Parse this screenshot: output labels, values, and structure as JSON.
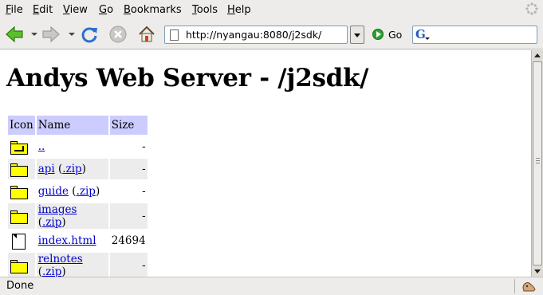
{
  "menu": {
    "items": [
      {
        "label": "File",
        "key": "F",
        "rest": "ile"
      },
      {
        "label": "Edit",
        "key": "E",
        "rest": "dit"
      },
      {
        "label": "View",
        "key": "V",
        "rest": "iew"
      },
      {
        "label": "Go",
        "key": "G",
        "rest": "o"
      },
      {
        "label": "Bookmarks",
        "key": "B",
        "rest": "ookmarks"
      },
      {
        "label": "Tools",
        "key": "T",
        "rest": "ools"
      },
      {
        "label": "Help",
        "key": "H",
        "rest": "elp"
      }
    ]
  },
  "toolbar": {
    "url": "http://nyangau:8080/j2sdk/",
    "go_label": "Go",
    "search_engine_letter": "G",
    "search_value": ""
  },
  "page": {
    "title": "Andys Web Server - /j2sdk/",
    "headers": {
      "icon": "Icon",
      "name": "Name",
      "size": "Size"
    },
    "rows": [
      {
        "icon": "parent-folder-icon",
        "name": "..",
        "zip": "",
        "size": "-"
      },
      {
        "icon": "folder-icon",
        "name": "api",
        "zip": ".zip",
        "size": "-"
      },
      {
        "icon": "folder-icon",
        "name": "guide",
        "zip": ".zip",
        "size": "-"
      },
      {
        "icon": "folder-icon",
        "name": "images",
        "zip": ".zip",
        "size": "-"
      },
      {
        "icon": "document-icon",
        "name": "index.html",
        "zip": "",
        "size": "24694"
      },
      {
        "icon": "folder-icon",
        "name": "relnotes",
        "zip": ".zip",
        "size": "-"
      }
    ]
  },
  "status": {
    "text": "Done"
  },
  "colors": {
    "header_bg": "#ccccff",
    "link": "#0000cc",
    "folder": "#ffff00"
  }
}
